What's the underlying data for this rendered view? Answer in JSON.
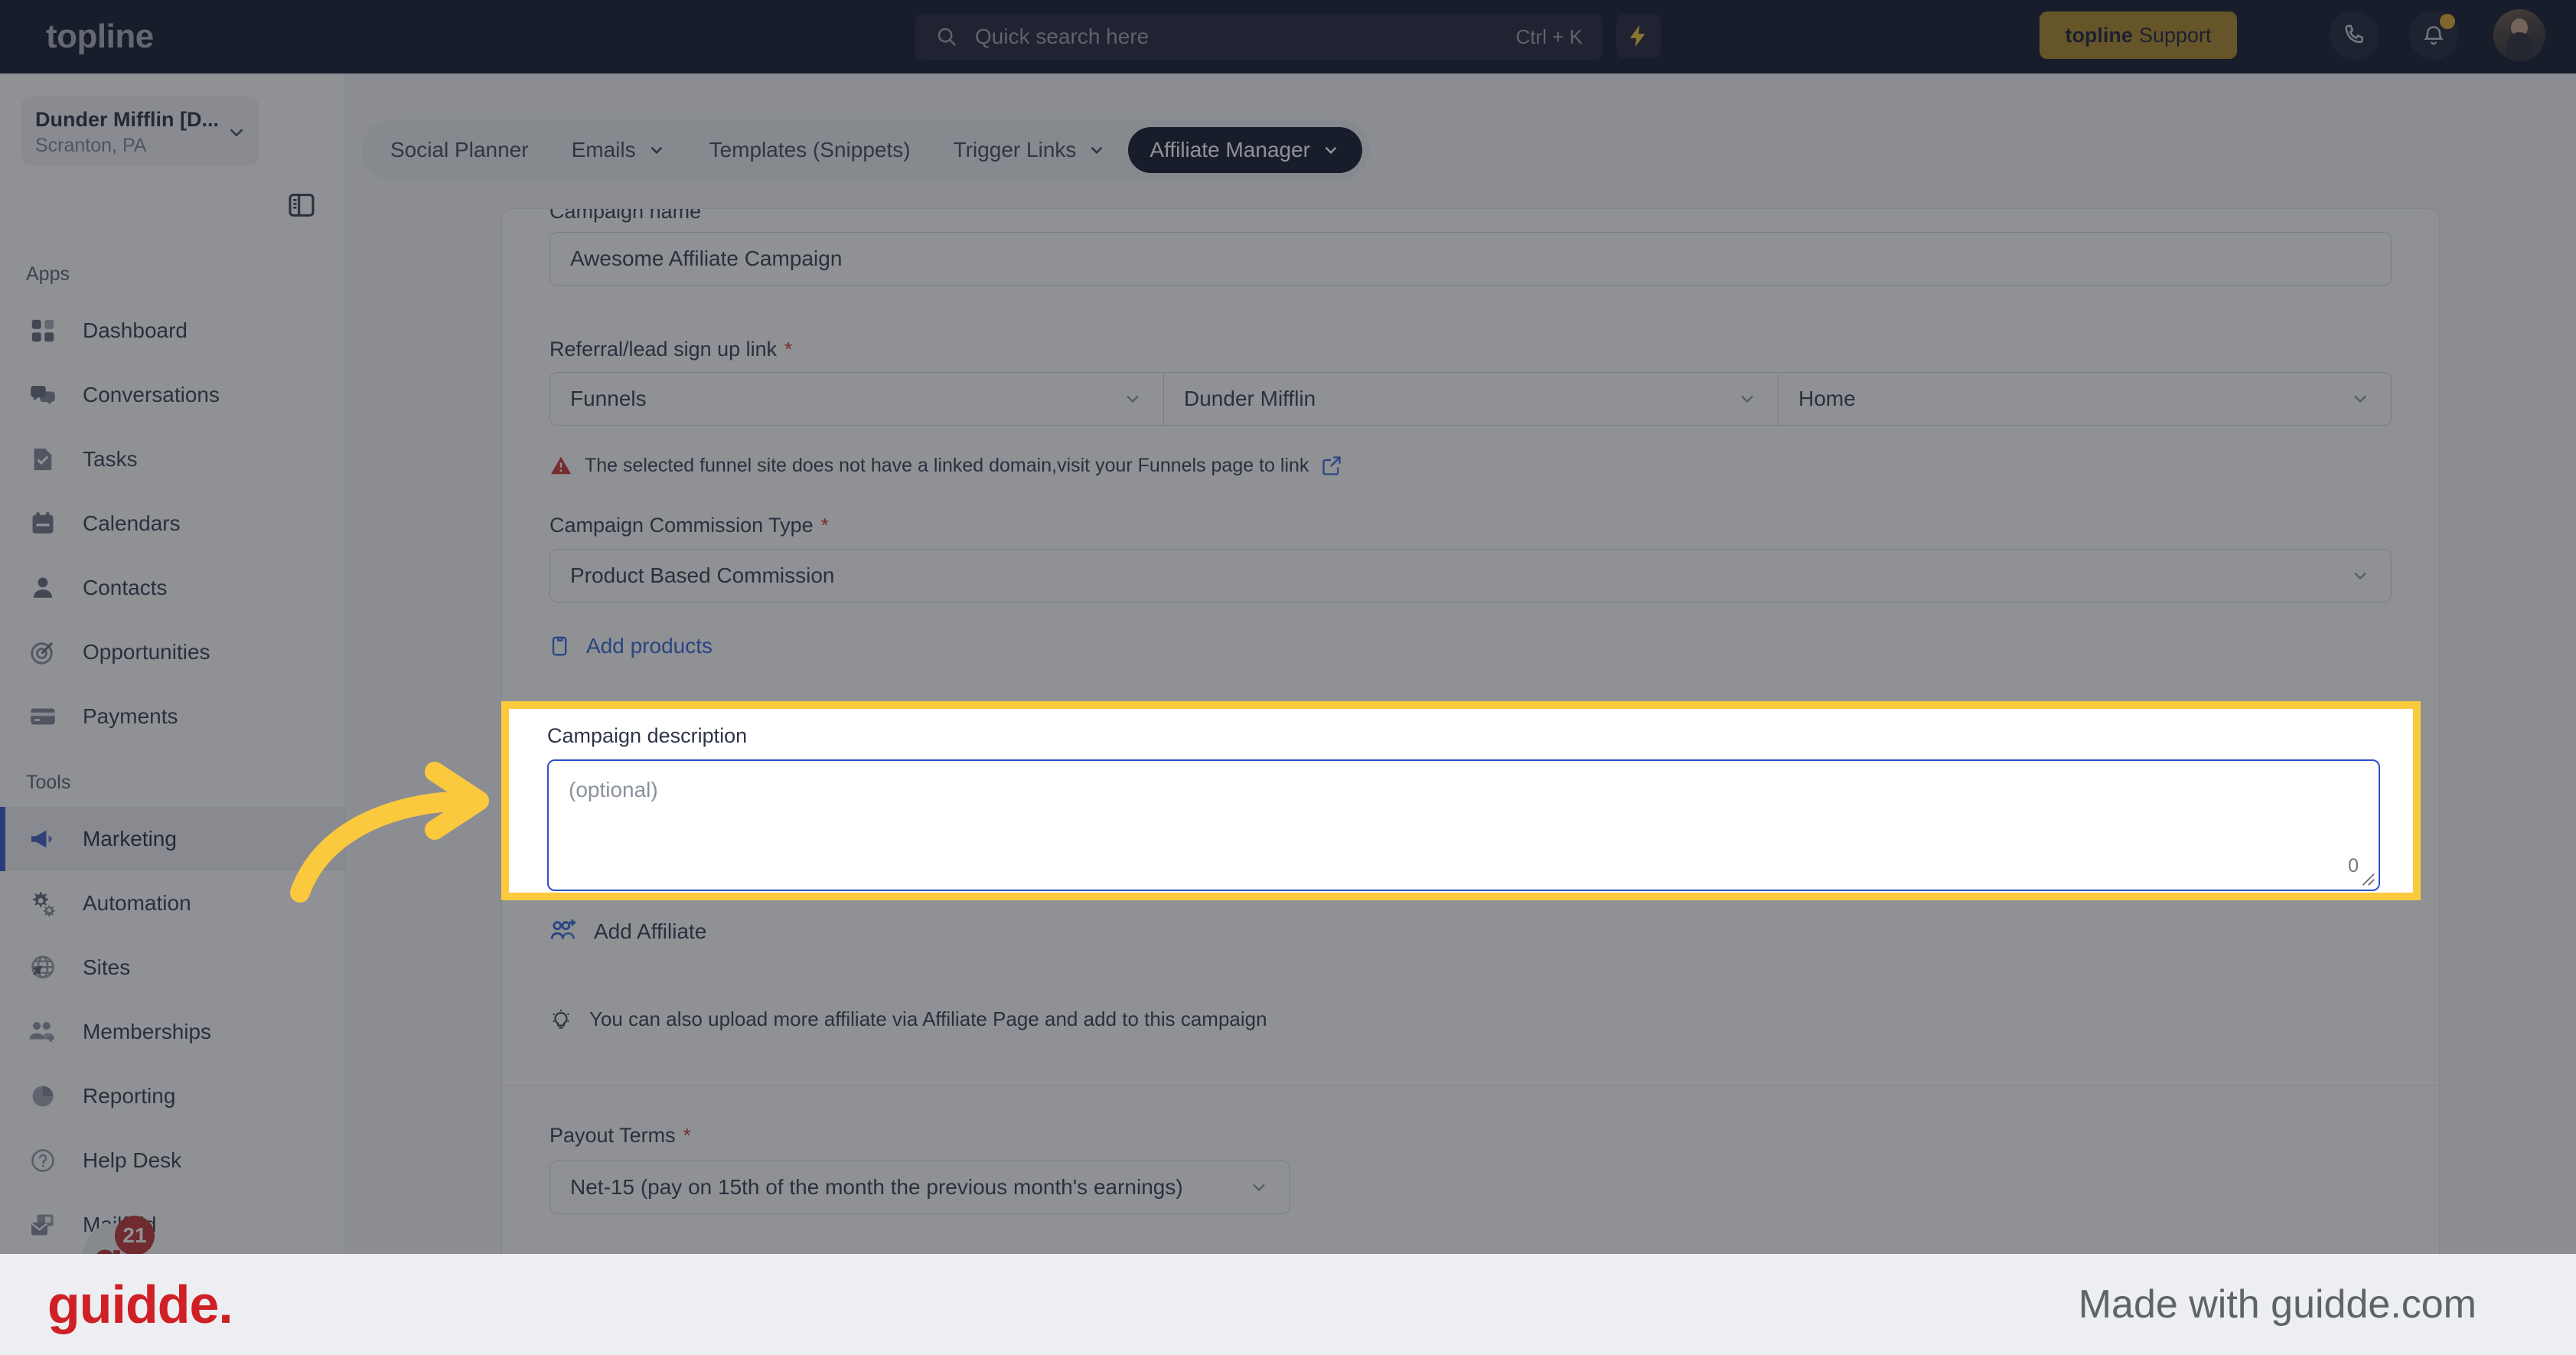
{
  "topbar": {
    "brand": "topline",
    "search": {
      "placeholder": "Quick search here",
      "shortcut": "Ctrl + K",
      "icon": "search-icon"
    },
    "bolt_icon": "lightning-bolt-icon",
    "support_button": {
      "brand": "topline",
      "label": "Support"
    },
    "phone_icon": "phone-icon",
    "bell_icon": "bell-icon",
    "avatar": "user-avatar"
  },
  "sidebar": {
    "location": {
      "name": "Dunder Mifflin [D...",
      "sub": "Scranton, PA",
      "caret": "chevron-down-icon"
    },
    "panel_toggle_icon": "side-panel-toggle-icon",
    "sections": [
      {
        "label": "Apps",
        "items": [
          {
            "label": "Dashboard",
            "icon": "dashboard-icon",
            "active": false
          },
          {
            "label": "Conversations",
            "icon": "chat-bubbles-icon",
            "active": false
          },
          {
            "label": "Tasks",
            "icon": "task-check-icon",
            "active": false
          },
          {
            "label": "Calendars",
            "icon": "calendar-icon",
            "active": false
          },
          {
            "label": "Contacts",
            "icon": "person-icon",
            "active": false
          },
          {
            "label": "Opportunities",
            "icon": "target-icon",
            "active": false
          },
          {
            "label": "Payments",
            "icon": "credit-card-icon",
            "active": false
          }
        ]
      },
      {
        "label": "Tools",
        "items": [
          {
            "label": "Marketing",
            "icon": "megaphone-icon",
            "active": true
          },
          {
            "label": "Automation",
            "icon": "gears-icon",
            "active": false
          },
          {
            "label": "Sites",
            "icon": "globe-icon",
            "active": false
          },
          {
            "label": "Memberships",
            "icon": "people-add-icon",
            "active": false
          },
          {
            "label": "Reporting",
            "icon": "pie-chart-icon",
            "active": false
          },
          {
            "label": "Help Desk",
            "icon": "question-icon",
            "active": false
          },
          {
            "label": "Mailfold",
            "icon": "mail-stack-icon",
            "active": false
          }
        ]
      }
    ],
    "mailfold_badge": {
      "letter": "g",
      "count": "21"
    }
  },
  "tabs": [
    {
      "label": "Social Planner",
      "caret": false,
      "active": false
    },
    {
      "label": "Emails",
      "caret": true,
      "active": false
    },
    {
      "label": "Templates (Snippets)",
      "caret": false,
      "active": false
    },
    {
      "label": "Trigger Links",
      "caret": true,
      "active": false
    },
    {
      "label": "Affiliate Manager",
      "caret": true,
      "active": true
    }
  ],
  "form": {
    "campaign_name": {
      "label": "Campaign name",
      "value": "Awesome Affiliate Campaign"
    },
    "referral_link": {
      "label": "Referral/lead sign up link",
      "required": "*",
      "type_value": "Funnels",
      "site_value": "Dunder Mifflin",
      "page_value": "Home",
      "warning": "The selected funnel site does not have a linked domain,visit your Funnels page to link",
      "warning_icon": "warning-triangle-icon",
      "external_link_icon": "external-link-icon"
    },
    "commission_type": {
      "label": "Campaign Commission Type",
      "required": "*",
      "value": "Product Based Commission"
    },
    "add_products": {
      "label": "Add products",
      "icon": "add-product-icon"
    },
    "campaign_description": {
      "label": "Campaign description",
      "placeholder": "(optional)",
      "value": "",
      "char_count": "0"
    },
    "add_affiliate": {
      "label": "Add Affiliate",
      "icon": "add-affiliate-icon"
    },
    "hint": {
      "icon": "lightbulb-icon",
      "text": "You can also upload more affiliate via Affiliate Page and add to this campaign"
    },
    "payout_terms": {
      "label": "Payout Terms",
      "required": "*",
      "value": "Net-15 (pay on 15th of the month the previous month's earnings)"
    }
  },
  "footer": {
    "logo": "guidde.",
    "made_with": "Made with guidde.com"
  },
  "colors": {
    "topbar_bg": "#080e23",
    "support_gold": "#a9821f",
    "accent_blue": "#2b51c9",
    "link_blue": "#2b60d8",
    "highlight_yellow": "#fbc93d",
    "warning_red": "#cc2b2b",
    "guidde_red": "#cf2026"
  }
}
